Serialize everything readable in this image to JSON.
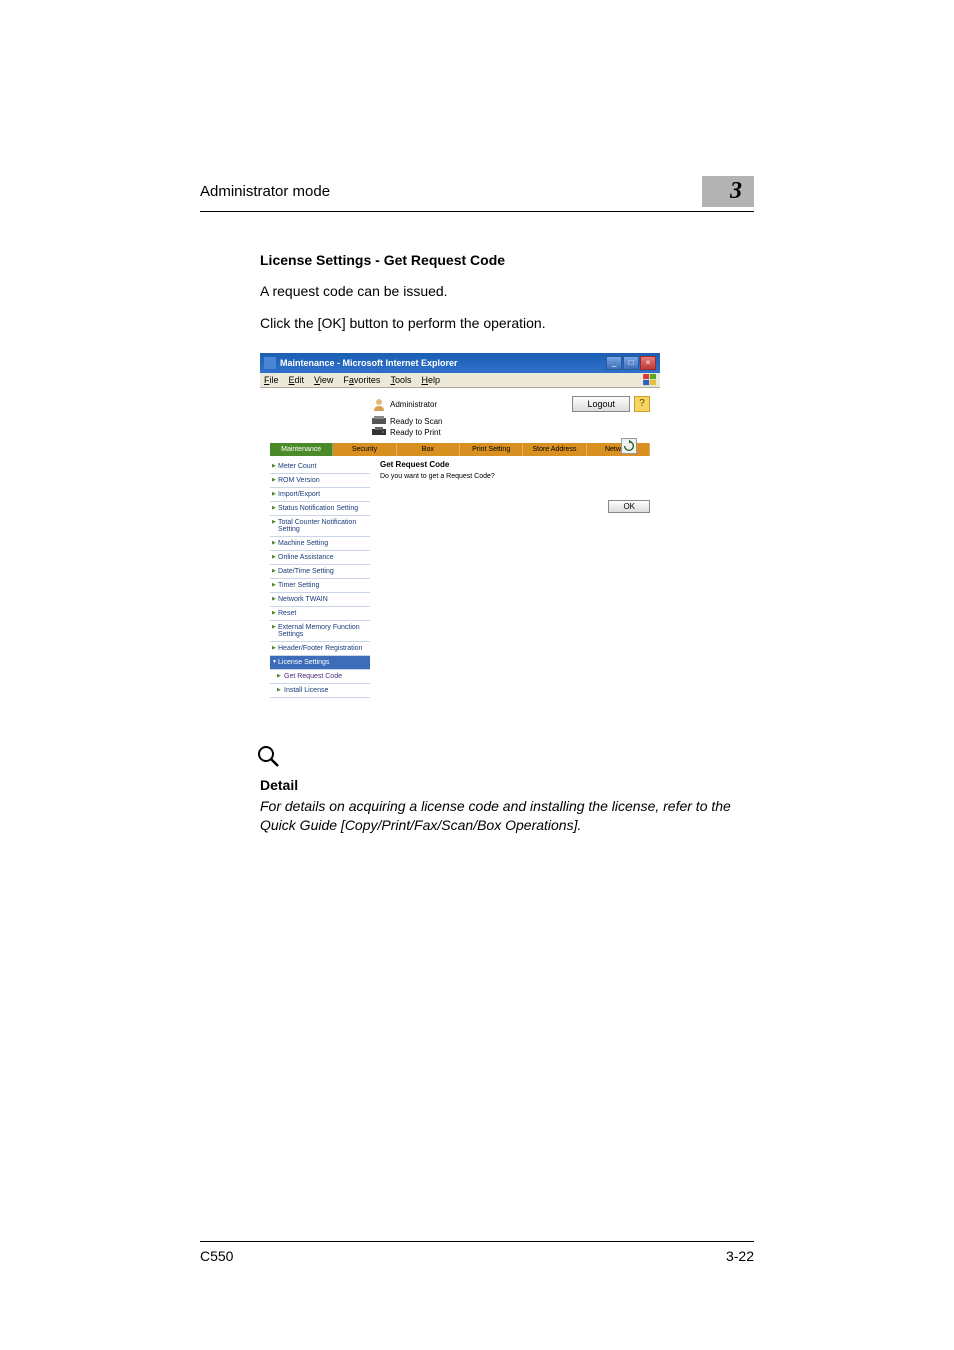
{
  "header": {
    "title": "Administrator mode",
    "chapter": "3"
  },
  "section": {
    "title": "License Settings - Get Request Code",
    "line1": "A request code can be issued.",
    "line2": "Click the [OK] button to perform the operation."
  },
  "screenshot": {
    "window_title": "Maintenance - Microsoft Internet Explorer",
    "menu": {
      "file": "File",
      "edit": "Edit",
      "view": "View",
      "favorites": "Favorites",
      "tools": "Tools",
      "help": "Help"
    },
    "admin_label": "Administrator",
    "logout": "Logout",
    "help": "?",
    "status_scan": "Ready to Scan",
    "status_print": "Ready to Print",
    "tabs": {
      "maintenance": "Maintenance",
      "security": "Security",
      "box": "Box",
      "print_setting": "Print Setting",
      "store_address": "Store Address",
      "network": "Network"
    },
    "sidebar": {
      "items": [
        "Meter Count",
        "ROM Version",
        "Import/Export",
        "Status Notification Setting",
        "Total Counter Notification Setting",
        "Machine Setting",
        "Online Assistance",
        "Date/Time Setting",
        "Timer Setting",
        "Network TWAIN",
        "Reset",
        "External Memory Function Settings",
        "Header/Footer Registration"
      ],
      "license_header": "License Settings",
      "get_request": "Get Request Code",
      "install_license": "Install License"
    },
    "content": {
      "heading": "Get Request Code",
      "question": "Do you want to get a Request Code?",
      "ok": "OK"
    }
  },
  "detail": {
    "heading": "Detail",
    "text": "For details on acquiring a license code and installing the license, refer to the Quick Guide [Copy/Print/Fax/Scan/Box Operations]."
  },
  "footer": {
    "model": "C550",
    "page": "3-22"
  }
}
